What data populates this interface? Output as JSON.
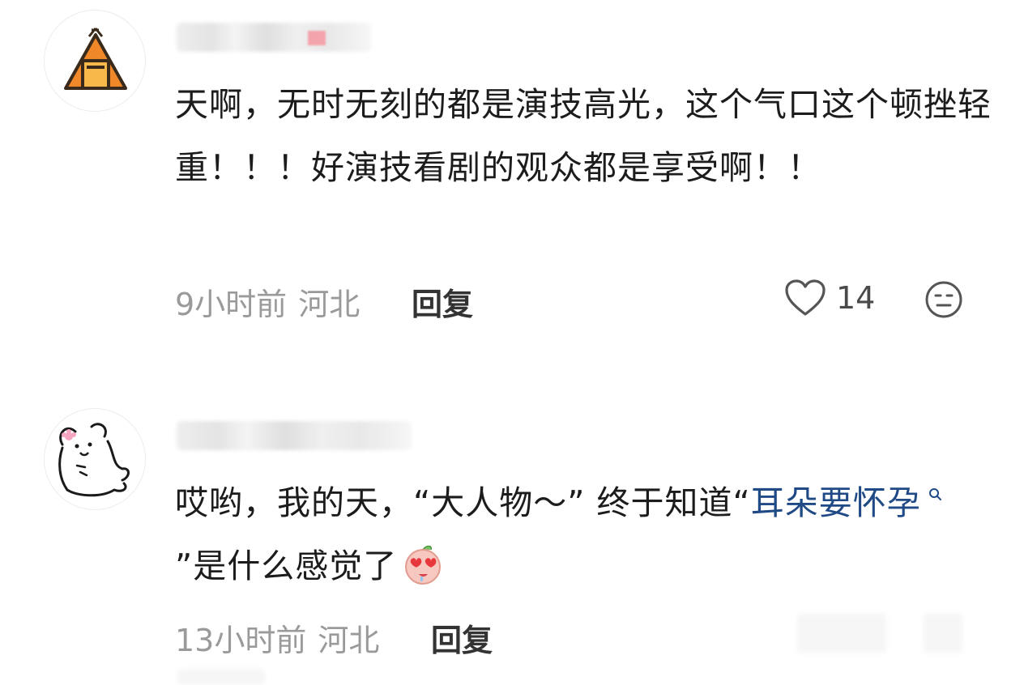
{
  "comments": [
    {
      "avatar_icon": "tent-icon",
      "text": "天啊，无时无刻的都是演技高光，这个气口这个顿挫轻重！！！好演技看剧的观众都是享受啊！！",
      "time": "9小时前",
      "location": "河北",
      "reply_label": "回复",
      "like_count": "14",
      "like_icon": "heart-icon",
      "react_icon": "smiley-face-icon"
    },
    {
      "avatar_icon": "bear-doodle-icon",
      "text_before": "哎哟，我的天，“大人物～” 终于知道“",
      "link_text": "耳朵要怀孕",
      "link_icon": "search-icon",
      "text_after": "”是什么感觉了",
      "emoji": "heart-eyes-peach-emoji",
      "time": "13小时前",
      "location": "河北",
      "reply_label": "回复"
    }
  ],
  "colors": {
    "text": "#1c1c1c",
    "meta": "#9a9a9a",
    "link": "#1f4a86",
    "avatar_orange": "#f0882a"
  }
}
